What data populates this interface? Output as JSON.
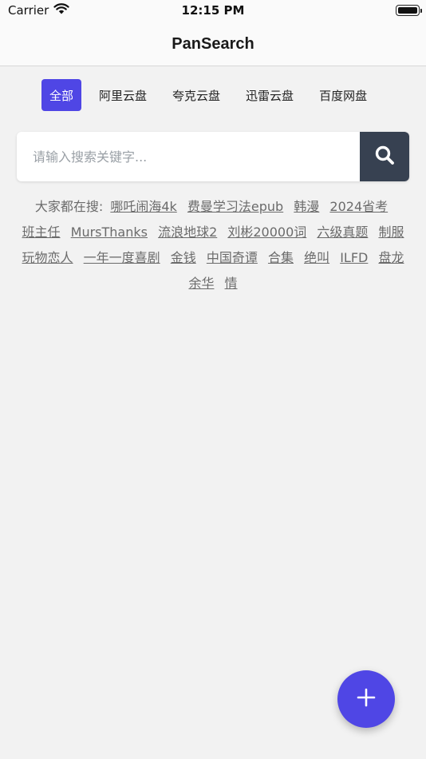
{
  "status_bar": {
    "carrier": "Carrier",
    "time": "12:15 PM"
  },
  "nav": {
    "title": "PanSearch"
  },
  "tabs": [
    {
      "label": "全部",
      "active": true
    },
    {
      "label": "阿里云盘",
      "active": false
    },
    {
      "label": "夸克云盘",
      "active": false
    },
    {
      "label": "迅雷云盘",
      "active": false
    },
    {
      "label": "百度网盘",
      "active": false
    }
  ],
  "search": {
    "placeholder": "请输入搜索关键字..."
  },
  "hot": {
    "prefix": "大家都在搜:",
    "terms": [
      "哪吒闹海4k",
      "费曼学习法epub",
      "韩漫",
      "2024省考",
      "班主任",
      "MursThanks",
      "流浪地球2",
      "刘彬20000词",
      "六级真题",
      "制服",
      "玩物恋人",
      "一年一度喜剧",
      "金钱",
      "中国奇谭",
      "合集",
      "绝叫",
      "ILFD",
      "盘龙",
      "余华",
      "情"
    ]
  },
  "colors": {
    "accent": "#4f46e5",
    "search_button": "#374151",
    "background": "#f2f2f2"
  },
  "icons": {
    "search": "search-icon",
    "add": "plus-icon",
    "wifi": "wifi-icon",
    "battery": "battery-icon"
  }
}
